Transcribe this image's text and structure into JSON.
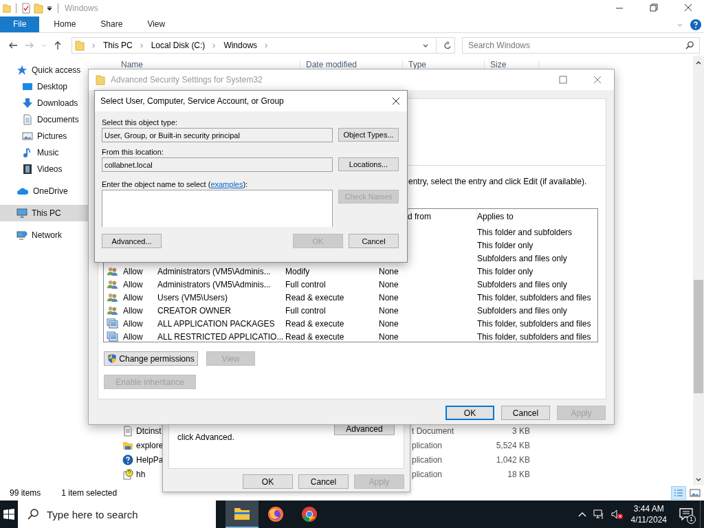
{
  "explorer": {
    "title": "Windows",
    "ribbon_tabs": [
      {
        "label": "File",
        "selected": true
      },
      {
        "label": "Home",
        "selected": false
      },
      {
        "label": "Share",
        "selected": false
      },
      {
        "label": "View",
        "selected": false
      }
    ],
    "breadcrumb": [
      "This PC",
      "Local Disk (C:)",
      "Windows"
    ],
    "search": {
      "placeholder": "Search Windows"
    },
    "columns": [
      "Name",
      "Date modified",
      "Type",
      "Size"
    ],
    "nav": [
      {
        "label": "Quick access",
        "kind": "star",
        "selected": false
      },
      {
        "label": "Desktop",
        "kind": "desktop",
        "selected": false
      },
      {
        "label": "Downloads",
        "kind": "download",
        "selected": false
      },
      {
        "label": "Documents",
        "kind": "document",
        "selected": false
      },
      {
        "label": "Pictures",
        "kind": "pictures",
        "selected": false
      },
      {
        "label": "Music",
        "kind": "music",
        "selected": false
      },
      {
        "label": "Videos",
        "kind": "video",
        "selected": false
      },
      {
        "label": "OneDrive",
        "kind": "cloud",
        "selected": false
      },
      {
        "label": "This PC",
        "kind": "pc",
        "selected": true
      },
      {
        "label": "Network",
        "kind": "network",
        "selected": false
      }
    ],
    "files": [
      {
        "name": "Dtcinst",
        "type": "t Document",
        "size": "3 KB",
        "kind": "text"
      },
      {
        "name": "explore",
        "type": "plication",
        "size": "5,524 KB",
        "kind": "folder"
      },
      {
        "name": "HelpPa",
        "type": "plication",
        "size": "1,042 KB",
        "kind": "help"
      },
      {
        "name": "hh",
        "type": "plication",
        "size": "18 KB",
        "kind": "helpdoc"
      }
    ],
    "status": {
      "count": "99 items",
      "selection": "1 item selected"
    }
  },
  "properties_dialog": {
    "note": "click Advanced.",
    "advanced_button": "Advanced",
    "buttons": [
      {
        "label": "OK",
        "disabled": false
      },
      {
        "label": "Cancel",
        "disabled": false
      },
      {
        "label": "Apply",
        "disabled": true
      }
    ]
  },
  "advanced_security": {
    "title": "Advanced Security Settings for System32",
    "instruction": "entry, select the entry and click Edit (if available).",
    "columns": {
      "inherited": "d from",
      "applies": "Applies to"
    },
    "entries": [
      {
        "applies_to": "This folder and subfolders"
      },
      {
        "applies_to": "This folder only"
      },
      {
        "applies_to": "Subfolders and files only"
      },
      {
        "kind": "user",
        "type": "Allow",
        "principal": "Administrators (VM5\\Adminis...",
        "access": "Modify",
        "inherited_from": "None",
        "applies_to": "This folder only"
      },
      {
        "kind": "user",
        "type": "Allow",
        "principal": "Administrators (VM5\\Adminis...",
        "access": "Full control",
        "inherited_from": "None",
        "applies_to": "Subfolders and files only"
      },
      {
        "kind": "user",
        "type": "Allow",
        "principal": "Users (VM5\\Users)",
        "access": "Read & execute",
        "inherited_from": "None",
        "applies_to": "This folder, subfolders and files"
      },
      {
        "kind": "user",
        "type": "Allow",
        "principal": "CREATOR OWNER",
        "access": "Full control",
        "inherited_from": "None",
        "applies_to": "Subfolders and files only"
      },
      {
        "kind": "package",
        "type": "Allow",
        "principal": "ALL APPLICATION PACKAGES",
        "access": "Read & execute",
        "inherited_from": "None",
        "applies_to": "This folder, subfolders and files"
      },
      {
        "kind": "package",
        "type": "Allow",
        "principal": "ALL RESTRICTED APPLICATIO...",
        "access": "Read & execute",
        "inherited_from": "None",
        "applies_to": "This folder, subfolders and files"
      }
    ],
    "actions": [
      {
        "label": "Change permissions",
        "shield": true,
        "disabled": false
      },
      {
        "label": "View",
        "shield": false,
        "disabled": true
      }
    ],
    "enable_inheritance": {
      "label": "Enable inheritance",
      "disabled": true
    },
    "buttons": [
      {
        "label": "OK",
        "default": true,
        "disabled": false
      },
      {
        "label": "Cancel",
        "default": false,
        "disabled": false
      },
      {
        "label": "Apply",
        "default": false,
        "disabled": true
      }
    ]
  },
  "select_dialog": {
    "title": "Select User, Computer, Service Account, or Group",
    "object_type_label": "Select this object type:",
    "object_type": "User, Group, or Built-in security principal",
    "object_types_button": "Object Types...",
    "location_label": "From this location:",
    "location": "collabnet.local",
    "locations_button": "Locations...",
    "name_label_start": "Enter the object name to select (",
    "examples_link": "examples",
    "name_label_end": "):",
    "check_names": {
      "label": "Check Names",
      "disabled": true
    },
    "advanced_button": "Advanced...",
    "buttons": [
      {
        "label": "OK",
        "disabled": true
      },
      {
        "label": "Cancel",
        "disabled": false
      }
    ]
  },
  "taskbar": {
    "search_placeholder": "Type here to search",
    "apps": [
      {
        "kind": "explorer",
        "selected": true
      },
      {
        "kind": "firefox",
        "selected": false
      },
      {
        "kind": "chrome",
        "selected": false
      }
    ],
    "time": "3:44 AM",
    "date": "4/11/2024",
    "notification_count": "1"
  }
}
